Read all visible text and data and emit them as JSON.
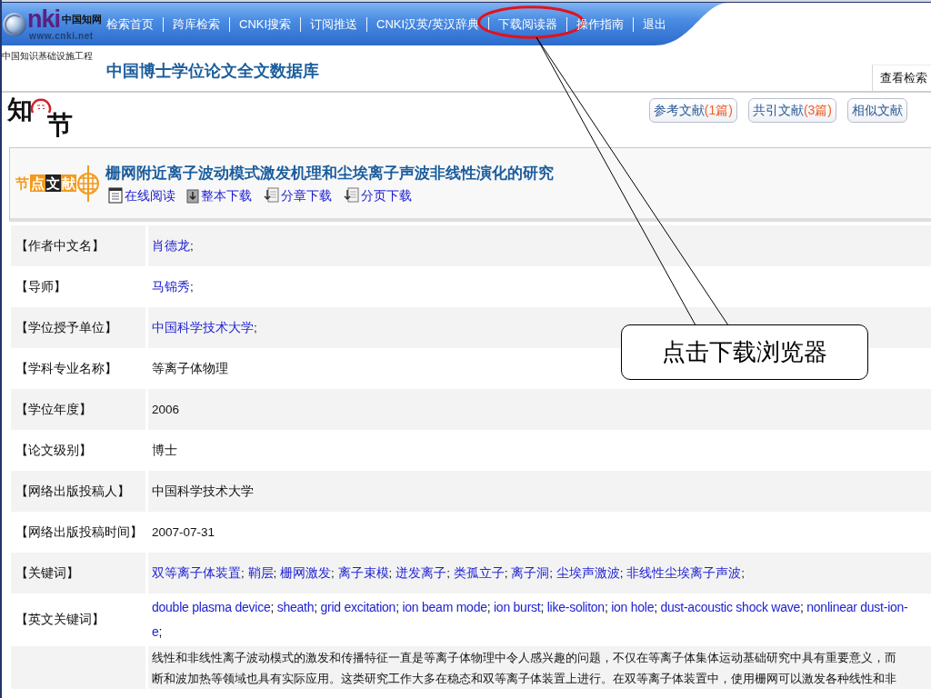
{
  "header": {
    "logo": {
      "mark": "nki",
      "name": "中国知网",
      "url": "www.cnki.net"
    },
    "nav": [
      {
        "label": "检索首页",
        "circled": false
      },
      {
        "label": "跨库检索",
        "circled": false
      },
      {
        "label": "CNKI搜索",
        "circled": false
      },
      {
        "label": "订阅推送",
        "circled": false
      },
      {
        "label": "CNKI汉英/英汉辞典",
        "circled": false
      },
      {
        "label": "下载阅读器",
        "circled": true
      },
      {
        "label": "操作指南",
        "circled": false
      },
      {
        "label": "退出",
        "circled": false
      }
    ]
  },
  "subheader": {
    "tagline": "中国知识基础设施工程",
    "database_title": "中国博士学位论文全文数据库",
    "history_link": "查看检索"
  },
  "node_bar": {
    "logo": {
      "left": "知",
      "right": "节"
    },
    "buttons": [
      {
        "label": "参考文献",
        "count": "(1篇)"
      },
      {
        "label": "共引文献",
        "count": "(3篇)"
      },
      {
        "label": "相似文献"
      }
    ]
  },
  "paper": {
    "badge": [
      {
        "char": "节",
        "kind": "plain"
      },
      {
        "char": "点",
        "kind": "orange"
      },
      {
        "char": "文",
        "kind": "dark"
      },
      {
        "char": "献",
        "kind": "orange"
      }
    ],
    "title": "栅网附近离子波动模式激发机理和尘埃离子声波非线性演化的研究",
    "actions": [
      {
        "label": "在线阅读",
        "kind": "read"
      },
      {
        "label": "整本下载",
        "kind": "whole"
      },
      {
        "label": "分章下载",
        "kind": "chapter"
      },
      {
        "label": "分页下载",
        "kind": "page"
      }
    ]
  },
  "details": [
    {
      "label": "【作者中文名】",
      "kind": "links",
      "values": [
        "肖德龙"
      ],
      "separator": ";"
    },
    {
      "label": "【导师】",
      "kind": "links",
      "values": [
        "马锦秀"
      ],
      "separator": ";"
    },
    {
      "label": "【学位授予单位】",
      "kind": "links",
      "values": [
        "中国科学技术大学"
      ],
      "separator": ";"
    },
    {
      "label": "【学科专业名称】",
      "kind": "text",
      "value": "等离子体物理"
    },
    {
      "label": "【学位年度】",
      "kind": "text",
      "value": "2006"
    },
    {
      "label": "【论文级别】",
      "kind": "text",
      "value": "博士"
    },
    {
      "label": "【网络出版投稿人】",
      "kind": "text",
      "value": "中国科学技术大学"
    },
    {
      "label": "【网络出版投稿时间】",
      "kind": "text",
      "value": "2007-07-31"
    },
    {
      "label": "【关键词】",
      "kind": "keywords",
      "values": [
        "双等离子体装置",
        "鞘层",
        "栅网激发",
        "离子束模",
        "迸发离子",
        "类孤立子",
        "离子洞",
        "尘埃声激波",
        "非线性尘埃离子声波"
      ],
      "separator": ";"
    },
    {
      "label": "【英文关键词】",
      "kind": "keywords",
      "values": [
        "double plasma device",
        "sheath",
        "grid excitation",
        "ion beam mode",
        "ion burst",
        "like-soliton",
        "ion hole",
        "dust-acoustic shock wave",
        "nonlinear dust-ion-"
      ],
      "separator": ";",
      "overflow_line": "e"
    },
    {
      "kind": "abstract",
      "lines": [
        "线性和非线性离子波动模式的激发和传播特征一直是等离子体物理中令人感兴趣的问题，不仅在等离子体集体运动基础研究中具有重要意义，而",
        "断和波加热等领域也具有实际应用。这类研究工作大多在稳态和双等离子体装置上进行。在双等离子体装置中，使用栅网可以激发各种线性和非"
      ]
    }
  ],
  "callout": {
    "text": "点击下载浏览器"
  }
}
